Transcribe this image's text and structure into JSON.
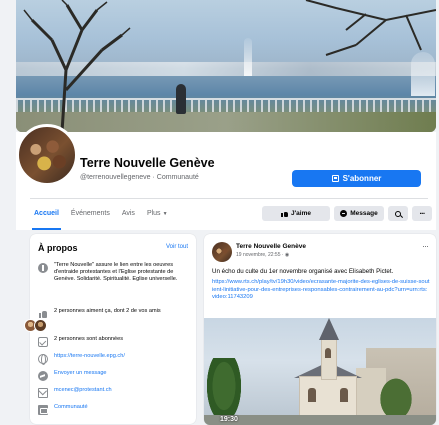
{
  "page": {
    "name": "Terre Nouvelle Genève",
    "handle": "@terrenouvellegeneve · Communauté",
    "subscribe_label": "S'abonner"
  },
  "tabs": [
    {
      "label": "Accueil",
      "active": true
    },
    {
      "label": "Événements",
      "active": false
    },
    {
      "label": "Avis",
      "active": false
    },
    {
      "label": "Plus",
      "active": false
    }
  ],
  "actions": {
    "like_label": "J'aime",
    "message_label": "Message"
  },
  "about": {
    "title": "À propos",
    "see_all": "Voir tout",
    "description": "\"Terre Nouvelle\" assure le lien entre les oeuvres d'entraide protestantes et l'Eglise protestante de Genève. Solidarité. Spiritualité. Eglise universelle.",
    "likes": "2 personnes aiment ça, dont 2 de vos amis",
    "followers": "2 personnes sont abonnées",
    "website": "https://terre-nouvelle.epg.ch/",
    "message": "Envoyer un message",
    "email": "mcenec@protestant.ch",
    "category": "Communauté"
  },
  "post": {
    "author": "Terre Nouvelle Genève",
    "date": "19 novembre, 22:55 · ",
    "text": "Un écho du culte du 1er novembre organisé avec Elisabeth Pictet.",
    "link": "https://www.rts.ch/play/tv/19h30/video/ecrasante-majorite-des-eglises-de-suisse-soutient-linitiative-pour-des-entreprises-responsables-contrairement-au-pdc?urn=urn:rts:video:11743209",
    "photo_badge": "19:30"
  },
  "colors": {
    "accent": "#1877f2",
    "background": "#f0f2f5",
    "card": "#ffffff",
    "secondary_text": "#65676b"
  }
}
